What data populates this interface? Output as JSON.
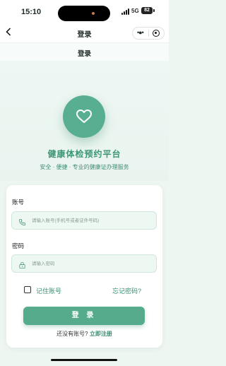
{
  "status_bar": {
    "time": "15:10",
    "network": "5G",
    "battery": "82"
  },
  "nav": {
    "back_icon": "chevron-left-icon",
    "title": "登录",
    "more_icon": "more-dots-icon",
    "record_icon": "target-icon"
  },
  "page": {
    "title": "登录"
  },
  "hero": {
    "logo_icon": "heart-icon",
    "app_title": "健康体检预约平台",
    "app_subtitle": "安全 · 便捷 · 专业的健康证办理服务"
  },
  "form": {
    "account_label": "账号",
    "account_placeholder": "请输入账号(手机号或者证件号码)",
    "account_icon": "phone-icon",
    "password_label": "密码",
    "password_placeholder": "请输入密码",
    "password_icon": "lock-icon",
    "remember_label": "记住账号",
    "forgot_label": "忘记密码?",
    "login_button": "登 录",
    "register_prompt": "还没有账号?",
    "register_link": "立即注册"
  },
  "colors": {
    "accent": "#56ab8c",
    "accent_text": "#3a8e70",
    "background": "#eef6f2"
  }
}
